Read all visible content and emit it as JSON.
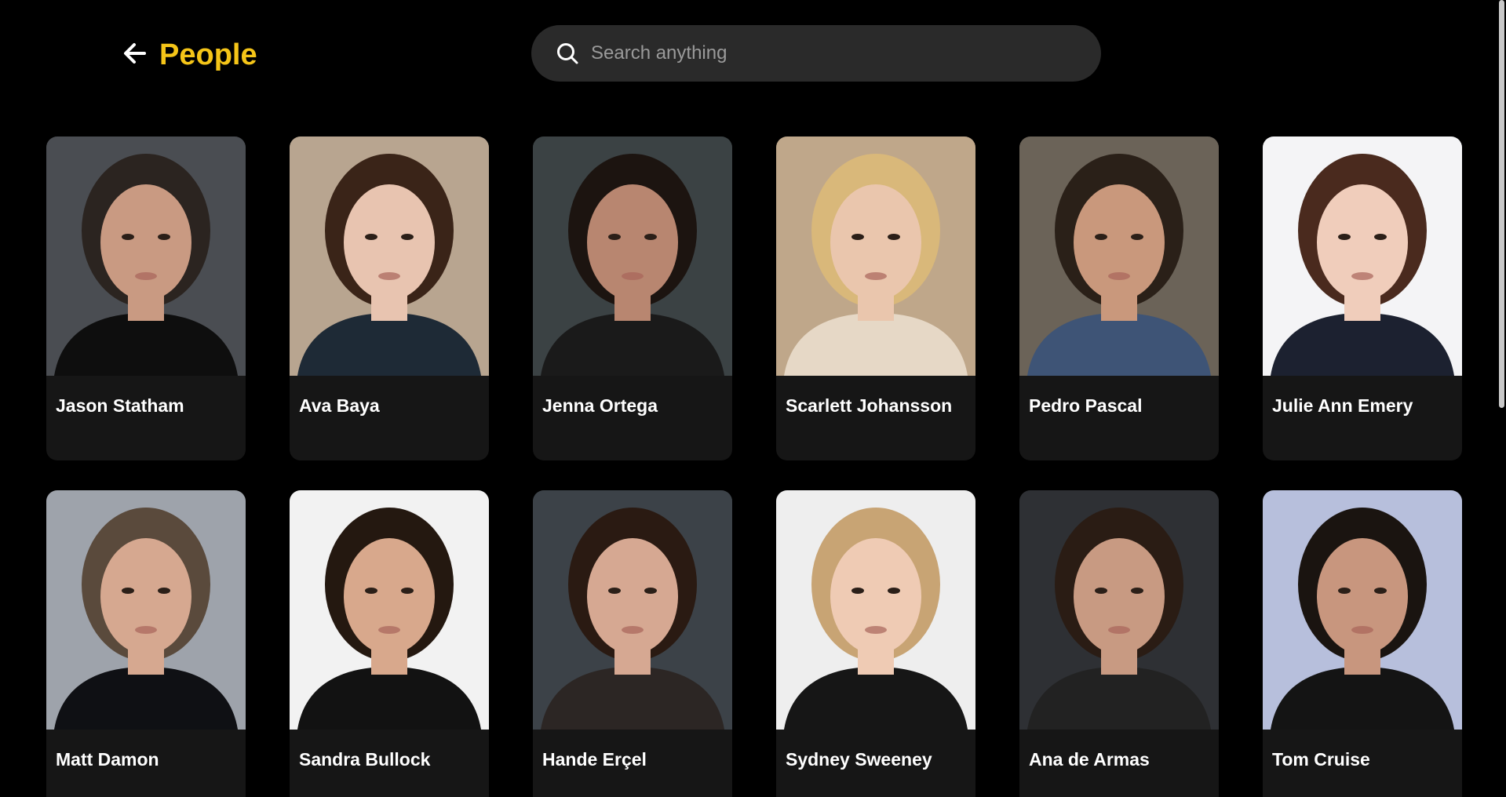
{
  "header": {
    "title": "People",
    "back_icon": "arrow-left-icon",
    "accent_color": "#f5c518"
  },
  "search": {
    "placeholder": "Search anything",
    "value": "",
    "icon": "search-icon"
  },
  "people": [
    {
      "name": "Jason Statham",
      "bg": "#4a4d52",
      "hair": "#2b2420",
      "skin": "#c99a82",
      "shirt": "#0e0e0e"
    },
    {
      "name": "Ava Baya",
      "bg": "#b8a590",
      "hair": "#3a2418",
      "skin": "#e8c4b0",
      "shirt": "#1e2a36"
    },
    {
      "name": "Jenna Ortega",
      "bg": "#3b4244",
      "hair": "#1c1410",
      "skin": "#b88670",
      "shirt": "#1a1a1a"
    },
    {
      "name": "Scarlett Johansson",
      "bg": "#bfa78a",
      "hair": "#d9b87a",
      "skin": "#eac6ad",
      "shirt": "#e6d8c6"
    },
    {
      "name": "Pedro Pascal",
      "bg": "#6b6358",
      "hair": "#2a2018",
      "skin": "#c9987c",
      "shirt": "#3e5476"
    },
    {
      "name": "Julie Ann Emery",
      "bg": "#f4f4f6",
      "hair": "#4a2a1e",
      "skin": "#f0cdbb",
      "shirt": "#1c2130"
    },
    {
      "name": "Matt Damon",
      "bg": "#9ea3ab",
      "hair": "#5a4a3c",
      "skin": "#d6a890",
      "shirt": "#0f1014"
    },
    {
      "name": "Sandra Bullock",
      "bg": "#f2f2f2",
      "hair": "#241810",
      "skin": "#d8a88c",
      "shirt": "#121212"
    },
    {
      "name": "Hande Erçel",
      "bg": "#3c4248",
      "hair": "#2a1a12",
      "skin": "#d6a892",
      "shirt": "#2c2624"
    },
    {
      "name": "Sydney Sweeney",
      "bg": "#eeeeee",
      "hair": "#c8a474",
      "skin": "#efcbb4",
      "shirt": "#161616"
    },
    {
      "name": "Ana de Armas",
      "bg": "#2e3034",
      "hair": "#2a1c14",
      "skin": "#c89a82",
      "shirt": "#222222"
    },
    {
      "name": "Tom Cruise",
      "bg": "#b7bfdc",
      "hair": "#1a1410",
      "skin": "#c8967e",
      "shirt": "#141414"
    }
  ]
}
